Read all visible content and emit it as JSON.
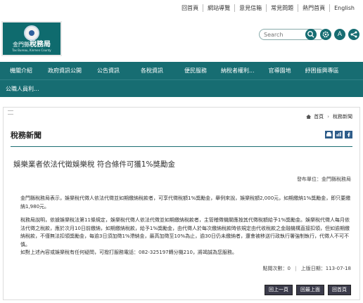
{
  "top_links": [
    "回首頁",
    "網站導覽",
    "意見信箱",
    "常見問題",
    "熱門首頁",
    "English"
  ],
  "logo": {
    "county": "金門縣",
    "bureau": "稅務局",
    "english": "Tax Bureau, Kinmen County"
  },
  "search": {
    "placeholder": "Search",
    "search_icon": "search-icon",
    "settings_icon": "gear-icon",
    "a_label": "A"
  },
  "nav": {
    "row1": [
      "機關介紹",
      "政府資訊公開",
      "公告資訊",
      "各稅資訊",
      "便民服務",
      "納稅者權利...",
      "官導園地",
      "紓困振興專區"
    ],
    "row2": [
      "公職人員利..."
    ]
  },
  "breadcrumb": {
    "home": "首頁",
    "current": "稅務新聞"
  },
  "page_title": "稅務新聞",
  "tools": [
    "print-icon",
    "share-icon",
    "facebook-icon"
  ],
  "article": {
    "title": "娛樂業者依法代徵娛樂稅 符合條件可獲1%獎勵金",
    "publisher": "發布單位：金門縣稅務局",
    "paragraphs": [
      "金門縣稅務局表示，娛樂稅代徵人依法代徵並如期繳納稅款者，可享代徵稅額1%獎勵金，舉例來說，娛樂稅額2,000元，如期繳納1%獎勵金，即只要繳納1,980元。",
      "稅務局說明，依據娛樂稅法第11條規定，娛樂稅代徵人依法代徵並如期繳納稅款者，主管稽徵機關應按其代徵稅額給予1%獎勵金。娛樂稅代徵人每月依法代徵之稅款，應於次月10日前繳納，如期繳納稅款，給予1%獎勵金，由代徵人於每次繳納稅款時依規定由代收稅款之金融機構直接扣領，但如逾期繳納稅款，不僅無法扣領獎勵金，每逾3日須加徵1%滯納金，最高加徵至10%為止，逾30日仍未繳納者，還會被移送行政執行署強制執行，代徵人不可不慎。",
      "如對上述內容或娛樂稅有任何疑問，可撥打服務電話：082-325197轉分機210，將竭誠為您服務。"
    ],
    "views": "點閱次數：0",
    "updated": "上版日期：113-07-18"
  },
  "buttons": [
    "回上一頁",
    "回最上面",
    "回首頁"
  ]
}
